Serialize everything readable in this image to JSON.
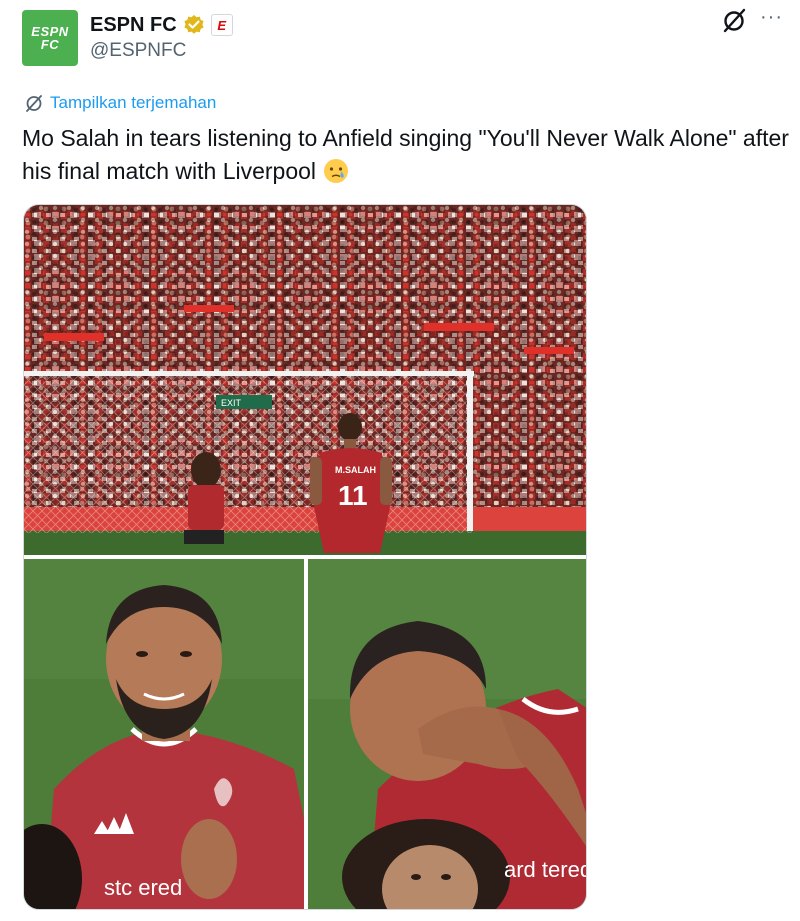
{
  "account": {
    "display_name": "ESPN FC",
    "handle": "@ESPNFC",
    "avatar_line1": "ESPN",
    "avatar_line2": "FC",
    "affiliate_badge": "E",
    "verified": true,
    "avatar_color": "#4caf50",
    "verified_color": "#e2b719"
  },
  "actions": {
    "grok_icon": "grok-icon",
    "more_label": "···"
  },
  "translate": {
    "label": "Tampilkan terjemahan",
    "color": "#1d9bf0"
  },
  "tweet": {
    "text": "Mo Salah in tears listening to Anfield singing \"You'll Never Walk Alone\" after his final match with Liverpool",
    "emoji": "crying-face-emoji"
  },
  "media": {
    "top_photo": {
      "shirt_name": "M.SALAH",
      "shirt_number": "11",
      "exit_sign": "EXIT"
    },
    "bottom_left_photo": {
      "sponsor_text": "stc ered"
    },
    "bottom_right_photo": {
      "sponsor_text": "ard tered"
    }
  }
}
